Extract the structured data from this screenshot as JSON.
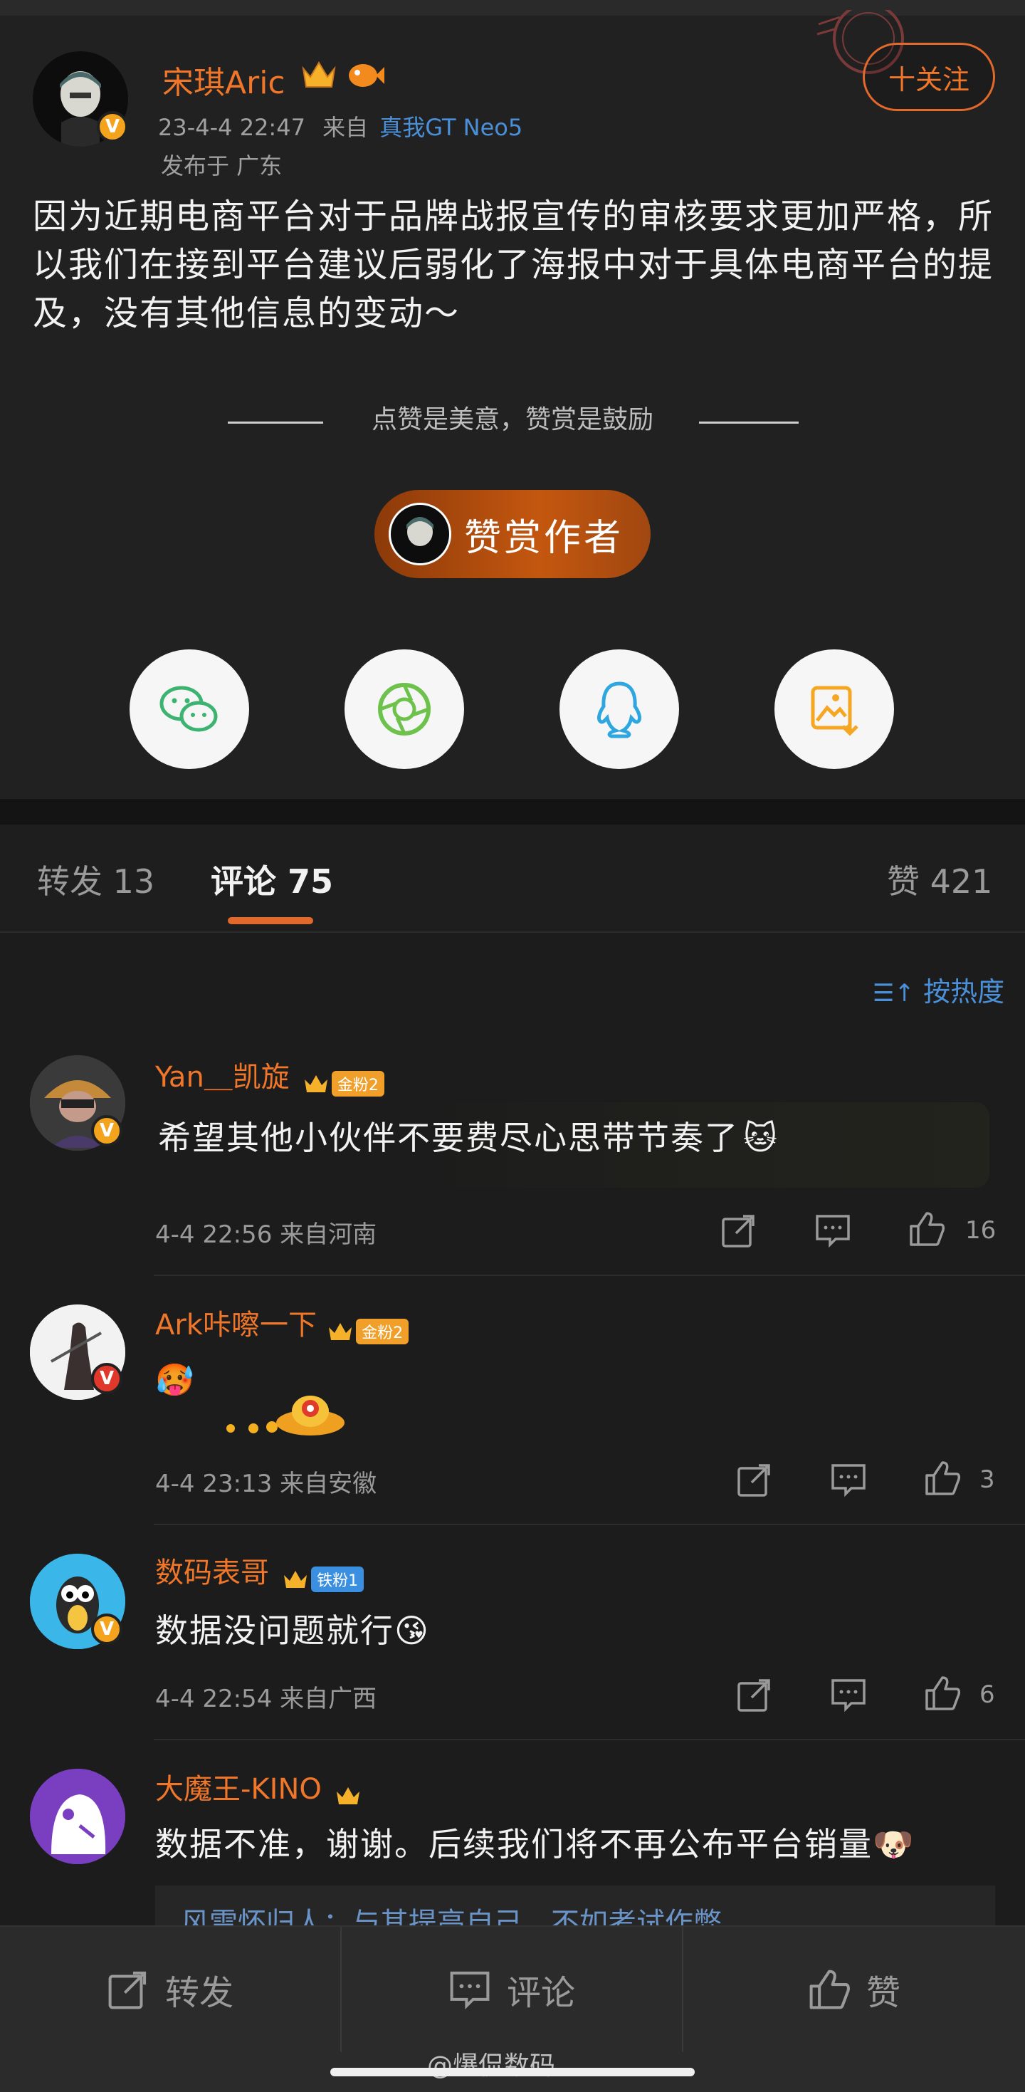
{
  "post": {
    "author": "宋琪Aric",
    "time": "23-4-4 22:47",
    "from_prefix": "来自",
    "device": "真我GT Neo5",
    "location": "发布于 广东",
    "follow_label": "十关注",
    "text": "因为近期电商平台对于品牌战报宣传的审核要求更加严格，所以我们在接到平台建议后弱化了海报中对于具体电商平台的提及，没有其他信息的变动～",
    "divider": "点赞是美意，赞赏是鼓励",
    "reward_label": "赞赏作者",
    "share_icons": [
      "wechat-icon",
      "moments-icon",
      "qq-icon",
      "save-image-icon"
    ]
  },
  "tabs": {
    "repost": "转发 13",
    "comment": "评论 75",
    "like": "赞 421"
  },
  "sort_label": "按热度",
  "comments": [
    {
      "name": "Yan＿凯旋",
      "fan": "金粉2",
      "text": "希望其他小伙伴不要费尽心思带节奏了",
      "meta": "4-4 22:56 来自河南",
      "likes": "16"
    },
    {
      "name": "Ark咔嚓一下",
      "fan": "金粉2",
      "text": "",
      "meta": "4-4 23:13 来自安徽",
      "likes": "3"
    },
    {
      "name": "数码表哥",
      "fan": "铁粉1",
      "text": "数据没问题就行",
      "meta": "4-4 22:54 来自广西",
      "likes": "6"
    },
    {
      "name": "大魔王-KINO",
      "fan": "",
      "text": "数据不准，谢谢。后续我们将不再公布平台销量",
      "reply": "风雷怀归人：与其提高自己，不如考试作弊"
    }
  ],
  "bottom": {
    "repost": "转发",
    "comment": "评论",
    "like": "赞"
  },
  "watermark": "@爆侃数码",
  "colors": {
    "accent": "#f0762a",
    "link": "#4a90d9",
    "background": "#1c1c1c"
  }
}
